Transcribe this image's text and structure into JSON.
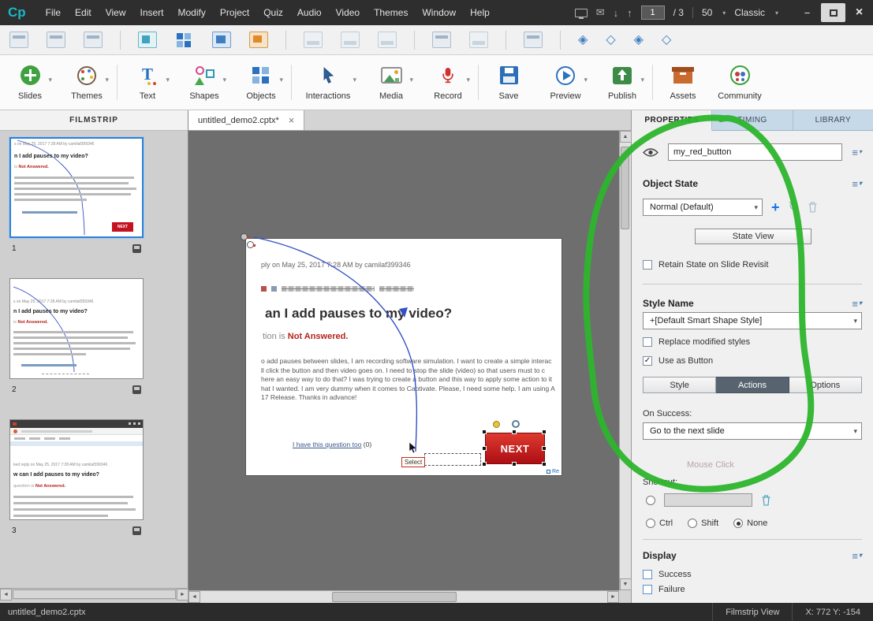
{
  "icons": {
    "caret_down": "▾",
    "envelope": "✉",
    "arrow_down": "↓",
    "arrow_up": "↑",
    "minimize": "−",
    "close": "×",
    "plus": "+",
    "refresh": "↻",
    "check": "✓",
    "menu": "≡",
    "left": "◄",
    "right": "►",
    "up": "▲",
    "down": "▼",
    "diamond": "◈",
    "diamond_outline": "◇"
  },
  "titlebar": {
    "logo": "Cp",
    "menus": [
      "File",
      "Edit",
      "View",
      "Insert",
      "Modify",
      "Project",
      "Quiz",
      "Audio",
      "Video",
      "Themes",
      "Window",
      "Help"
    ],
    "slide_current": "1",
    "slide_total": "/  3",
    "zoom": "50",
    "workspace": "Classic"
  },
  "main_toolbar": {
    "items": [
      {
        "label": "Slides"
      },
      {
        "label": "Themes"
      },
      {
        "label": "Text"
      },
      {
        "label": "Shapes"
      },
      {
        "label": "Objects"
      },
      {
        "label": "Interactions"
      },
      {
        "label": "Media"
      },
      {
        "label": "Record"
      },
      {
        "label": "Save"
      },
      {
        "label": "Preview"
      },
      {
        "label": "Publish"
      },
      {
        "label": "Assets"
      },
      {
        "label": "Community"
      }
    ]
  },
  "filmstrip": {
    "title": "FILMSTRIP",
    "slide_numbers": [
      "1",
      "2",
      "3"
    ]
  },
  "document_tab": {
    "title": "untitled_demo2.cptx*"
  },
  "slide": {
    "meta": "ply on May 25, 2017 7:28 AM by camilaf399346",
    "heading": "an I add pauses to my video?",
    "status_prefix": "tion is ",
    "status": "Not Answered.",
    "body": [
      "o add pauses between slides, I am recording software simulation. I want to create a simple interac",
      "ll click the button and then video goes on. I need to stop the slide (video) so that users must to c",
      "here an easy way to do that? I was trying to create a button and this way to apply some action to it",
      "hat I wanted. I am very dummy when it comes to Captivate. Please, I need some help. I am using A",
      "17 Release. Thanks in advance!"
    ],
    "link_text": "I have this question too",
    "link_suffix": " (0)",
    "next_button": "NEXT",
    "select_tooltip": "Select",
    "reply_link": "Re"
  },
  "thumbs": {
    "t1": {
      "meta": "s on May 25, 2017 7:28 AM by camilaf399346",
      "heading": "n I add pauses to my video?",
      "status_prefix": "is ",
      "status": "Not Answered.",
      "next": "NEXT"
    },
    "t3": {
      "meta": "ked reply on May 25, 2017 7:28 AM by camilaf399346",
      "heading": "w can I add pauses to my video?",
      "status_prefix": "question is ",
      "status": "Not Answered."
    }
  },
  "properties": {
    "tabs": [
      "PROPERTIES",
      "TIMING",
      "LIBRARY"
    ],
    "object_name": "my_red_button",
    "object_state": {
      "label": "Object State",
      "state_value": "Normal (Default)",
      "state_view": "State View",
      "retain": "Retain State on Slide Revisit"
    },
    "style": {
      "label": "Style Name",
      "value": "+[Default Smart Shape Style]",
      "replace": "Replace modified styles",
      "use_as_button": "Use as Button"
    },
    "subtabs": [
      "Style",
      "Actions",
      "Options"
    ],
    "actions": {
      "on_success_label": "On Success:",
      "on_success_value": "Go to the next slide",
      "mouse_click": "Mouse Click",
      "shortcut_label": "Shortcut:",
      "modifiers": [
        "Ctrl",
        "Shift",
        "None"
      ]
    },
    "display": {
      "label": "Display",
      "options": [
        "Success",
        "Failure"
      ]
    }
  },
  "statusbar": {
    "filename": "untitled_demo2.cptx",
    "view": "Filmstrip View",
    "coords": "X: 772 Y: -154"
  }
}
